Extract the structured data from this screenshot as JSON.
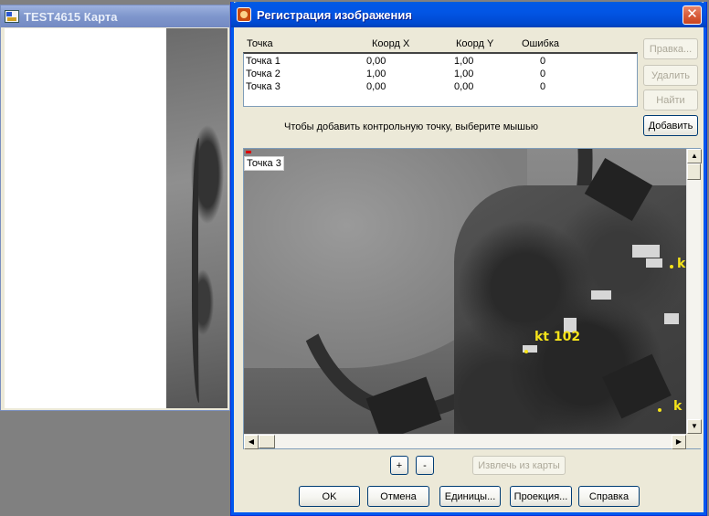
{
  "bg_window": {
    "title": "TEST4615 Карта"
  },
  "dialog": {
    "title": "Регистрация изображения",
    "close_glyph": "✕",
    "columns": {
      "point": "Точка",
      "x": "Коорд X",
      "y": "Коорд Y",
      "error": "Ошибка"
    },
    "rows": [
      {
        "point": "Точка 1",
        "x": "0,00",
        "y": "1,00",
        "error": "0"
      },
      {
        "point": "Точка 2",
        "x": "1,00",
        "y": "1,00",
        "error": "0"
      },
      {
        "point": "Точка 3",
        "x": "0,00",
        "y": "0,00",
        "error": "0"
      }
    ],
    "side_buttons": {
      "edit": "Правка...",
      "delete": "Удалить",
      "find": "Найти",
      "add": "Добавить"
    },
    "hint": "Чтобы добавить контрольную точку, выберите мышью",
    "viewport": {
      "point_tag": "Точка 3",
      "markers": [
        {
          "label": "kt 102"
        },
        {
          "label": "k"
        },
        {
          "label": "k"
        }
      ]
    },
    "zoom": {
      "plus": "+",
      "minus": "-",
      "extract": "Извлечь из карты"
    },
    "footer": {
      "ok": "OK",
      "cancel": "Отмена",
      "units": "Единицы...",
      "projection": "Проекция...",
      "help": "Справка"
    },
    "icons": {
      "title_icon": "image-registration-icon",
      "close": "close-icon"
    }
  }
}
